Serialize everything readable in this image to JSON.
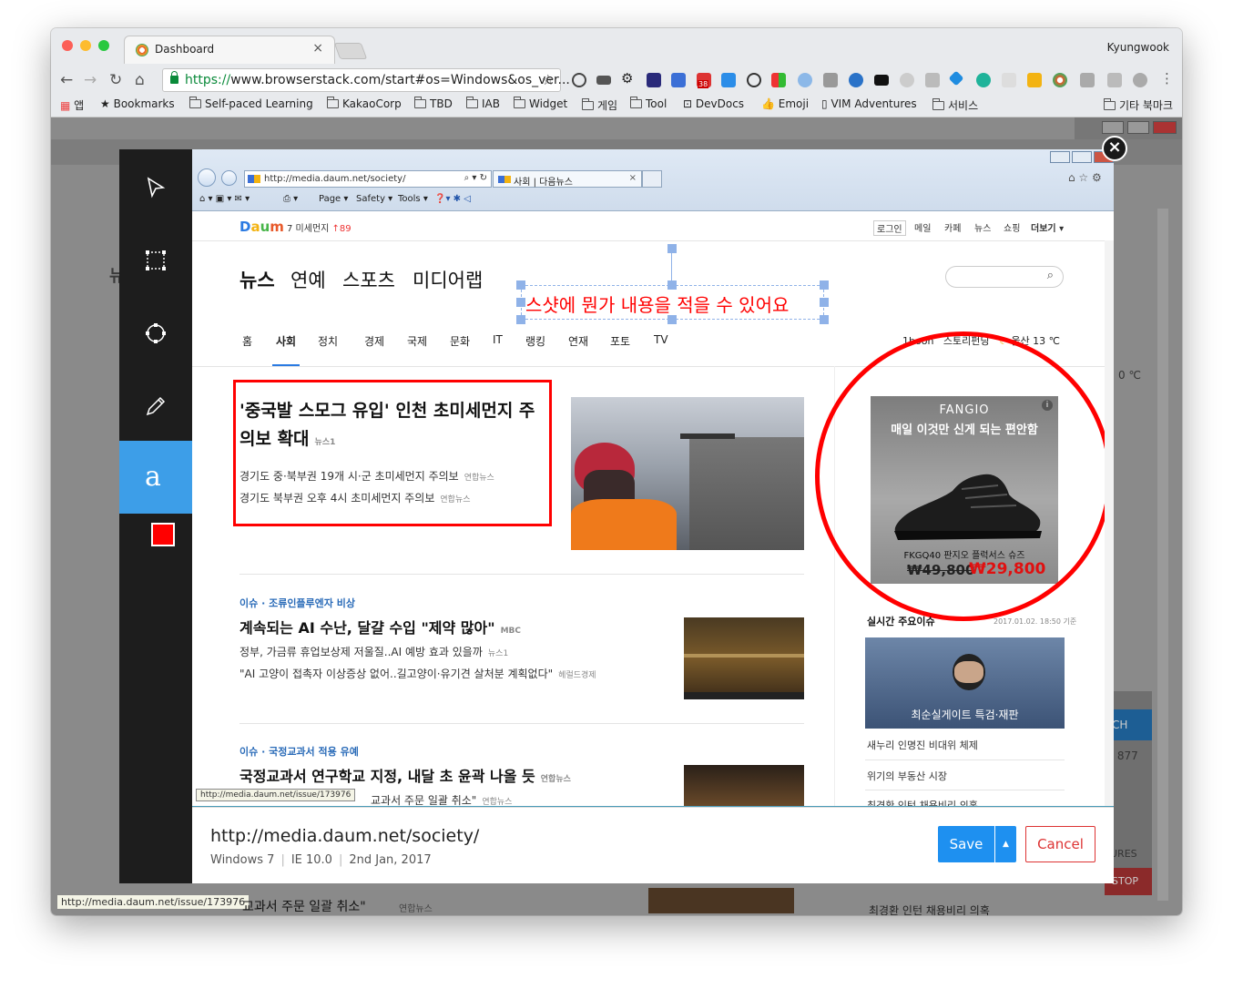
{
  "browser": {
    "tab_title": "Dashboard",
    "profile_name": "Kyungwook",
    "url_secure": "https://",
    "url_rest": "www.browserstack.com/start#os=Windows&os_ver...",
    "bookmarks": [
      "앱",
      "Bookmarks",
      "Self-paced Learning",
      "KakaoCorp",
      "TBD",
      "IAB",
      "Widget",
      "게임",
      "Tool",
      "DevDocs",
      "Emoji",
      "VIM Adventures",
      "서비스"
    ],
    "other_bookmarks": "기타 북마크",
    "ext_badge": "38"
  },
  "background_page": {
    "status_url": "http://media.daum.net/issue/173976",
    "behind_text": "교과서 주문 일괄 취소\"",
    "behind_source": "연합뉴스",
    "behind_right": "최경환 인턴 채용비리 의혹",
    "behind_temp": "0 ℃",
    "behind_count": ": 877",
    "behind_ch": "CH",
    "behind_ures": "URES",
    "behind_stop": "STOP"
  },
  "annotation_tools": [
    "select-tool",
    "crop-tool",
    "shape-tool",
    "pen-tool",
    "text-tool",
    "color-swatch"
  ],
  "annotation_text": "스샷에 뭔가 내용을 적을 수 있어요",
  "colors": {
    "accent": "#1e90f0",
    "annotation": "#ff0000",
    "tool_active": "#3d9ee8"
  },
  "ie": {
    "address": "http://media.daum.net/society/",
    "tab_title": "사회 | 다음뉴스",
    "commands": [
      "Page ▾",
      "Safety ▾",
      "Tools ▾"
    ]
  },
  "daum": {
    "logo": "Daum",
    "weather_top": "7 미세먼지",
    "weather_rank": "↑89",
    "gnb": [
      "로그인",
      "메일",
      "카페",
      "뉴스",
      "쇼핑",
      "더보기 ▾"
    ],
    "top_nav": [
      "뉴스",
      "연예",
      "스포츠",
      "미디어랩"
    ],
    "categories": [
      "홈",
      "사회",
      "정치",
      "경제",
      "국제",
      "문화",
      "IT",
      "랭킹",
      "연재",
      "포토",
      "TV"
    ],
    "right_nav": "1boon   스토리펀딩",
    "weather_city": "울산 13 ℃",
    "main_headline": "'중국발 스모그 유입' 인천 초미세먼지 주의보 확대",
    "main_headline_source": "뉴스1",
    "main_subs": [
      {
        "text": "경기도 중·북부권 19개 시·군 초미세먼지 주의보",
        "source": "연합뉴스"
      },
      {
        "text": "경기도 북부권 오후 4시 초미세먼지 주의보",
        "source": "연합뉴스"
      }
    ],
    "issue1_tag": "이슈 · 조류인플루엔자 비상",
    "issue1_headline": "계속되는 AI 수난, 달걀 수입 \"제약 많아\"",
    "issue1_source": "MBC",
    "issue1_subs": [
      {
        "text": "정부, 가금류 휴업보상제 저울질..AI 예방 효과 있을까",
        "source": "뉴스1"
      },
      {
        "text": "\"AI 고양이 접촉자 이상증상 없어..길고양이·유기견 살처분 계획없다\"",
        "source": "헤럴드경제"
      }
    ],
    "issue2_tag": "이슈 · 국정교과서 적용 유예",
    "issue2_headline": "국정교과서 연구학교 지정, 내달 초 윤곽 나올 듯",
    "issue2_source": "연합뉴스",
    "issue2_sub_text": "교과서 주문 일괄 취소\"",
    "issue2_sub_source": "연합뉴스",
    "ad": {
      "brand": "FANGIO",
      "tagline": "매일 이것만 신게 되는 편안함",
      "product": "FKGQ40 판지오 플럭서스 슈즈",
      "old_price": "₩49,800",
      "new_price": "₩29,800"
    },
    "realtime_title": "실시간 주요이슈",
    "realtime_time": "2017.01.02. 18:50 기준",
    "realtime_banner": "최순실게이트 특검·재판",
    "realtime_links": [
      "새누리 인명진 비대위 체제",
      "위기의 부동산 시장",
      "최경환 인턴 채용비리 의혹"
    ],
    "status_tooltip": "http://media.daum.net/issue/173976"
  },
  "footer": {
    "url": "http://media.daum.net/society/",
    "os": "Windows 7",
    "browser": "IE 10.0",
    "date": "2nd Jan, 2017",
    "save_label": "Save",
    "cancel_label": "Cancel"
  }
}
